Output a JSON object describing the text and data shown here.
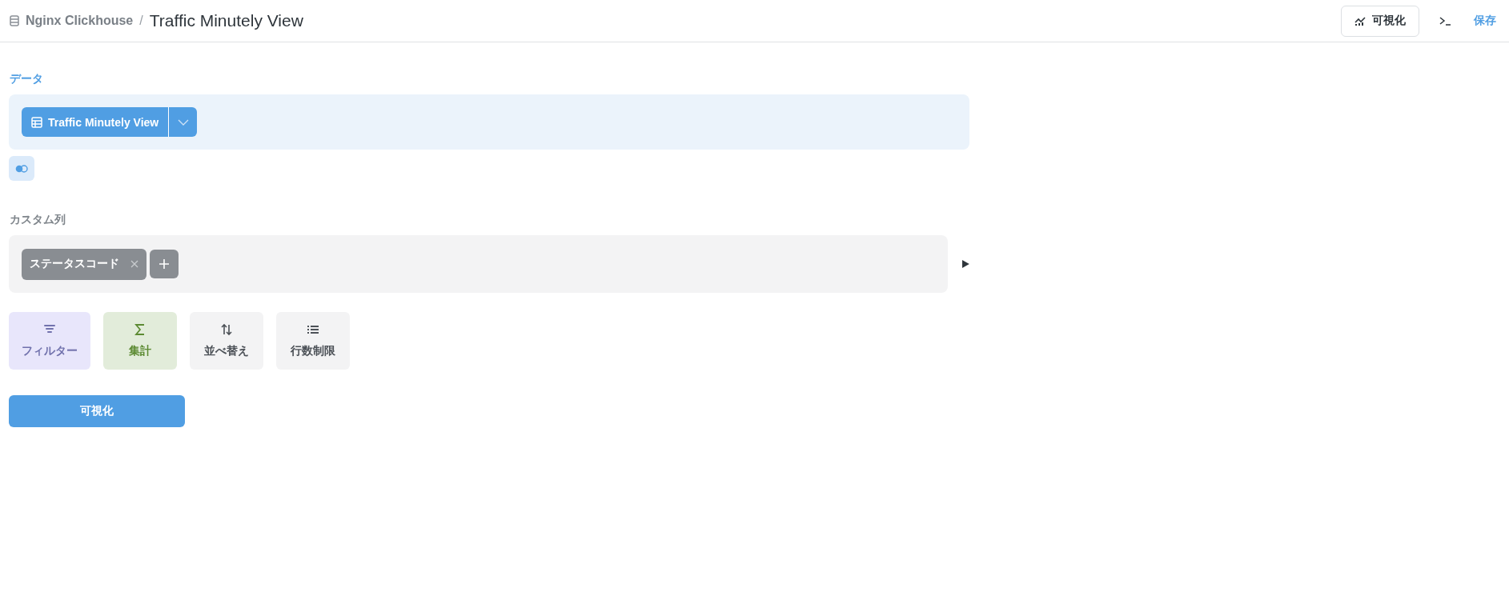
{
  "header": {
    "database": "Nginx Clickhouse",
    "separator": "/",
    "title": "Traffic Minutely View",
    "visualize_label": "可視化",
    "save_label": "保存"
  },
  "data_step": {
    "label": "データ",
    "table": "Traffic Minutely View"
  },
  "custom_columns_step": {
    "label": "カスタム列",
    "columns": [
      "ステータスコード"
    ]
  },
  "actions": [
    {
      "kind": "filter",
      "label": "フィルター"
    },
    {
      "kind": "summarize",
      "label": "集計"
    },
    {
      "kind": "sort",
      "label": "並べ替え"
    },
    {
      "kind": "limit",
      "label": "行数制限"
    }
  ],
  "visualize_button": "可視化"
}
